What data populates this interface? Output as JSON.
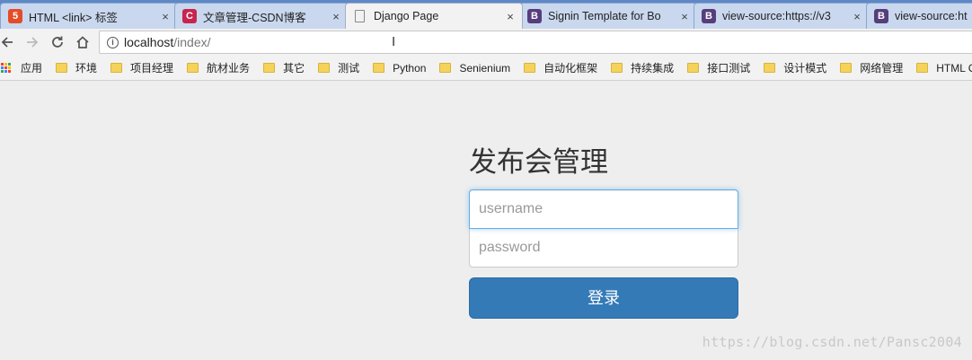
{
  "tabs": [
    {
      "title": "HTML <link> 标签",
      "icon": "html5-icon",
      "active": false
    },
    {
      "title": "文章管理-CSDN博客",
      "icon": "csdn-icon",
      "active": false
    },
    {
      "title": "Django Page",
      "icon": "page-icon",
      "active": true
    },
    {
      "title": "Signin Template for Bo",
      "icon": "bootstrap-icon",
      "active": false
    },
    {
      "title": "view-source:https://v3",
      "icon": "bootstrap-icon",
      "active": false
    },
    {
      "title": "view-source:ht",
      "icon": "bootstrap-icon",
      "active": false
    }
  ],
  "fav_letters": {
    "csdn": "C",
    "boot": "B",
    "html5": "5"
  },
  "tab_close_glyph": "×",
  "address": {
    "host": "localhost",
    "path": "/index/"
  },
  "bookmarks": {
    "apps_label": "应用",
    "items": [
      "环境",
      "项目经理",
      "航材业务",
      "其它",
      "测试",
      "Python",
      "Senienium",
      "自动化框架",
      "持续集成",
      "接口测试",
      "设计模式",
      "网络管理",
      "HTML C"
    ]
  },
  "form": {
    "heading": "发布会管理",
    "username_placeholder": "username",
    "password_placeholder": "password",
    "submit_label": "登录"
  },
  "watermark": "https://blog.csdn.net/Pansc2004",
  "colors": {
    "primary": "#337ab7",
    "tabstrip": "#5e88c6",
    "page_bg": "#eeeeee"
  }
}
